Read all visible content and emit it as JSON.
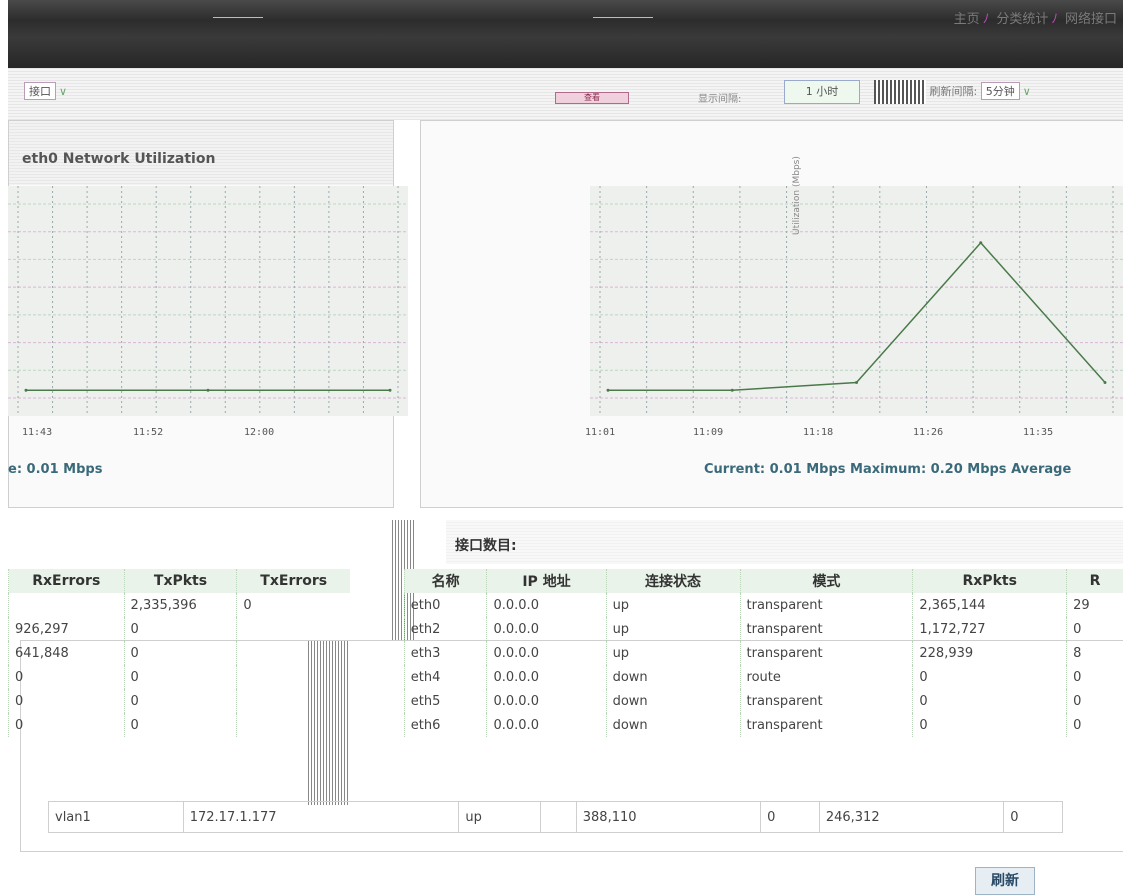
{
  "header": {
    "links": [
      "主页",
      "分类统计",
      "网络接口"
    ]
  },
  "controls": {
    "left_select": "接口",
    "view_button": "查看",
    "interval_label": "显示间隔:",
    "interval_value": "1 小时",
    "refresh_label": "刷新间隔:",
    "refresh_value": "5分钟"
  },
  "chart": {
    "title": "eth0 Network Utilization",
    "y_axis_label": "Utilization (Mbps)",
    "left_ticks": [
      "11:43",
      "11:52",
      "12:00"
    ],
    "right_ticks": [
      "11:01",
      "11:09",
      "11:18",
      "11:26",
      "11:35"
    ],
    "left_stats": "e: 0.01 Mbps",
    "right_stats": "Current: 0.01 Mbps Maximum: 0.20 Mbps Average"
  },
  "chart_data": {
    "type": "line",
    "title": "eth0 Network Utilization",
    "ylabel": "Utilization (Mbps)",
    "x": [
      "11:01",
      "11:09",
      "11:18",
      "11:26",
      "11:35",
      "11:43",
      "11:52",
      "12:00"
    ],
    "series": [
      {
        "values": [
          0.01,
          0.01,
          0.02,
          0.2,
          0.02,
          0.01,
          0.01,
          0.01
        ]
      }
    ],
    "stats": {
      "current": 0.01,
      "maximum": 0.2,
      "unit": "Mbps"
    }
  },
  "interfaces": {
    "count_label": "接口数目:",
    "left_headers": [
      "RxErrors",
      "TxPkts",
      "TxErrors"
    ],
    "right_headers": [
      "名称",
      "IP 地址",
      "连接状态",
      "模式",
      "RxPkts",
      "R"
    ],
    "left_rows": [
      [
        "",
        "2,335,396",
        "0"
      ],
      [
        "926,297",
        "0",
        ""
      ],
      [
        "641,848",
        "0",
        ""
      ],
      [
        "0",
        "0",
        ""
      ],
      [
        "0",
        "0",
        ""
      ],
      [
        "0",
        "0",
        ""
      ]
    ],
    "right_rows": [
      [
        "eth0",
        "0.0.0.0",
        "up",
        "transparent",
        "2,365,144",
        "29"
      ],
      [
        "eth2",
        "0.0.0.0",
        "up",
        "transparent",
        "1,172,727",
        "0"
      ],
      [
        "eth3",
        "0.0.0.0",
        "up",
        "transparent",
        "228,939",
        "8"
      ],
      [
        "eth4",
        "0.0.0.0",
        "down",
        "route",
        "0",
        "0"
      ],
      [
        "eth5",
        "0.0.0.0",
        "down",
        "transparent",
        "0",
        "0"
      ],
      [
        "eth6",
        "0.0.0.0",
        "down",
        "transparent",
        "0",
        "0"
      ]
    ],
    "vlan_row": [
      "vlan1",
      "172.17.1.177",
      "up",
      "",
      "388,110",
      "0",
      "246,312",
      "0"
    ]
  },
  "refresh_button": "刷新"
}
